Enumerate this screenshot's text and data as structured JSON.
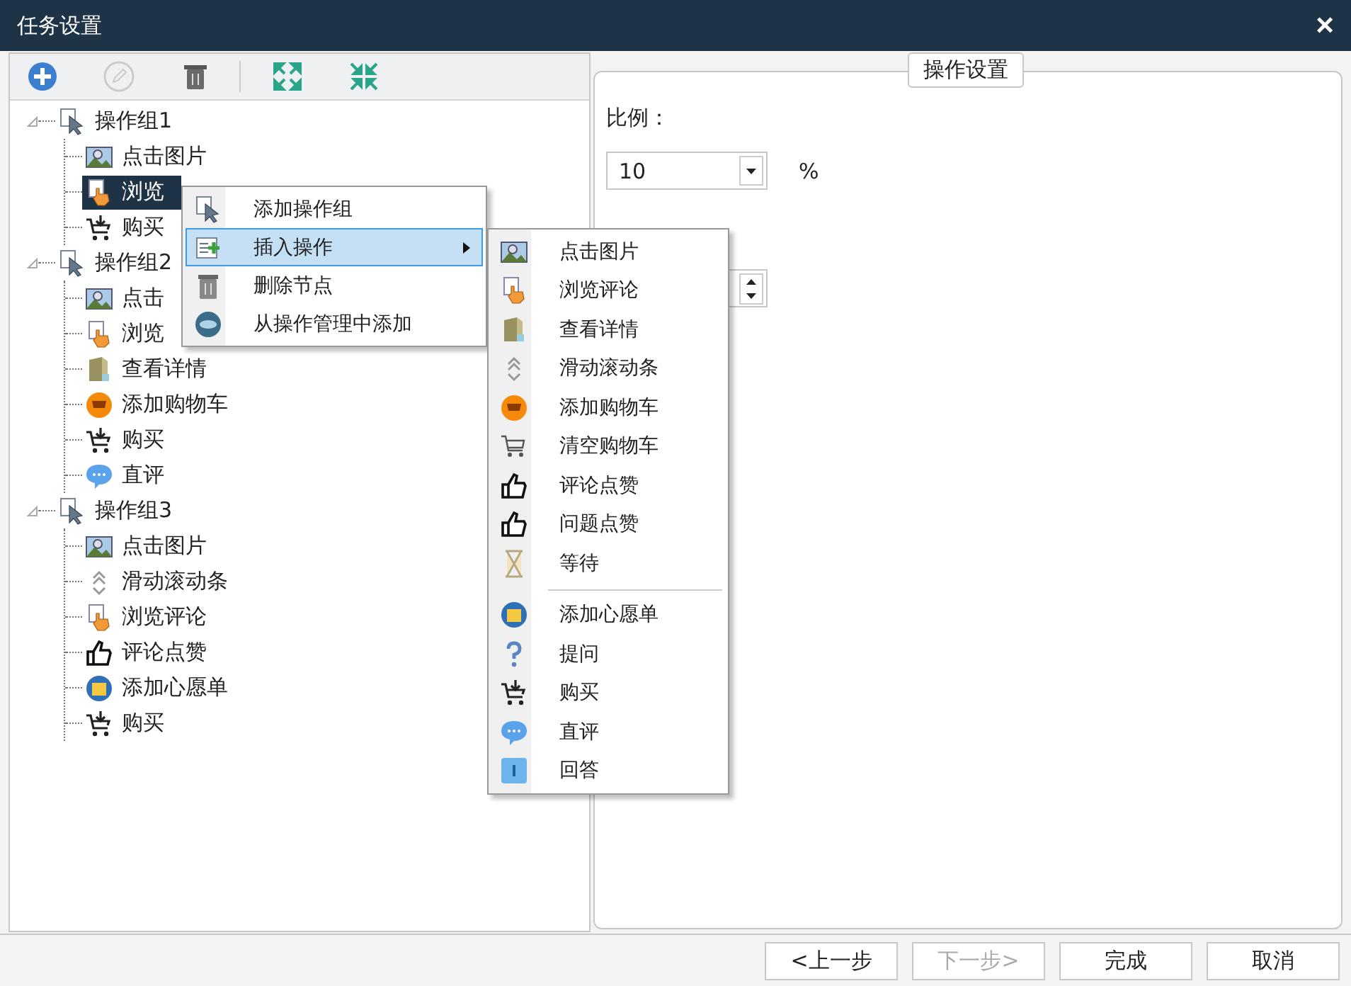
{
  "window": {
    "title": "任务设置",
    "close": "×"
  },
  "toolbar": [
    {
      "kind": "add",
      "disabled": false
    },
    {
      "kind": "edit",
      "disabled": true
    },
    {
      "kind": "delete",
      "disabled": false
    },
    {
      "kind": "expand",
      "disabled": false
    },
    {
      "kind": "collapse",
      "disabled": false
    }
  ],
  "tree": [
    {
      "label": "操作组1",
      "expanded": true,
      "selected": false,
      "children": [
        {
          "label": "点击图片",
          "kind": "picture",
          "selected": false
        },
        {
          "label": "浏览",
          "kind": "browse",
          "selected": true
        },
        {
          "label": "购买",
          "kind": "buy",
          "selected": false
        }
      ]
    },
    {
      "label": "操作组2",
      "expanded": true,
      "selected": false,
      "children": [
        {
          "label": "点击",
          "kind": "picture",
          "selected": false
        },
        {
          "label": "浏览",
          "kind": "browse",
          "selected": false
        },
        {
          "label": "查看详情",
          "kind": "details",
          "selected": false
        },
        {
          "label": "添加购物车",
          "kind": "addcart",
          "selected": false
        },
        {
          "label": "购买",
          "kind": "buy",
          "selected": false
        },
        {
          "label": "直评",
          "kind": "review",
          "selected": false
        }
      ]
    },
    {
      "label": "操作组3",
      "expanded": true,
      "selected": false,
      "children": [
        {
          "label": "点击图片",
          "kind": "picture",
          "selected": false
        },
        {
          "label": "滑动滚动条",
          "kind": "scroll",
          "selected": false
        },
        {
          "label": "浏览评论",
          "kind": "browse",
          "selected": false
        },
        {
          "label": "评论点赞",
          "kind": "like",
          "selected": false
        },
        {
          "label": "添加心愿单",
          "kind": "wishlist",
          "selected": false
        },
        {
          "label": "购买",
          "kind": "buy",
          "selected": false
        }
      ]
    }
  ],
  "context_menu": [
    {
      "label": "添加操作组",
      "kind": "pointer",
      "selected": false,
      "submenu": false
    },
    {
      "label": "插入操作",
      "kind": "insert",
      "selected": true,
      "submenu": true
    },
    {
      "label": "删除节点",
      "kind": "trash",
      "selected": false,
      "submenu": false
    },
    {
      "label": "从操作管理中添加",
      "kind": "manage",
      "selected": false,
      "submenu": false
    }
  ],
  "submenu": [
    {
      "label": "点击图片",
      "kind": "picture"
    },
    {
      "label": "浏览评论",
      "kind": "browse"
    },
    {
      "label": "查看详情",
      "kind": "details"
    },
    {
      "label": "滑动滚动条",
      "kind": "scroll"
    },
    {
      "label": "添加购物车",
      "kind": "addcart"
    },
    {
      "label": "清空购物车",
      "kind": "clearcart"
    },
    {
      "label": "评论点赞",
      "kind": "like"
    },
    {
      "label": "问题点赞",
      "kind": "like"
    },
    {
      "label": "等待",
      "kind": "wait"
    },
    {
      "kind": "separator"
    },
    {
      "label": "添加心愿单",
      "kind": "wishlist"
    },
    {
      "label": "提问",
      "kind": "ask"
    },
    {
      "label": "购买",
      "kind": "buy"
    },
    {
      "label": "直评",
      "kind": "review"
    },
    {
      "label": "回答",
      "kind": "answer"
    }
  ],
  "settings": {
    "legend": "操作设置",
    "ratio_label": "比例：",
    "ratio_value": "10",
    "unit": "%"
  },
  "buttons": [
    {
      "label": "<上一步",
      "disabled": false
    },
    {
      "label": "下一步>",
      "disabled": true
    },
    {
      "label": "完成",
      "disabled": false
    },
    {
      "label": "取消",
      "disabled": false
    }
  ]
}
